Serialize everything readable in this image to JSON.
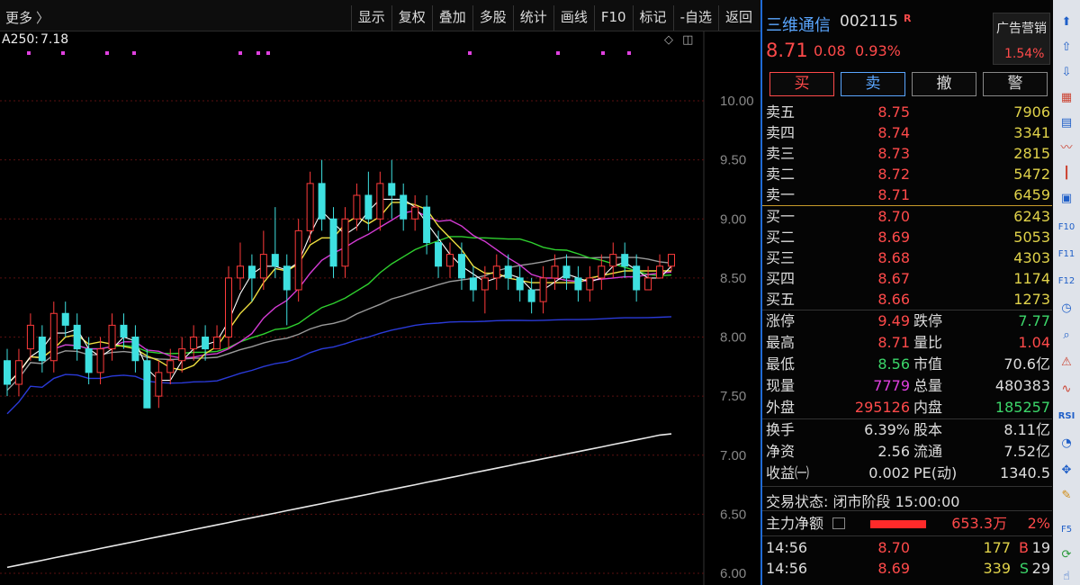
{
  "toolbar": {
    "more_label": "更多",
    "more_arrow": "〉",
    "buttons": [
      "显示",
      "复权",
      "叠加",
      "多股",
      "统计",
      "画线",
      "F10",
      "标记",
      "-自选",
      "返回"
    ]
  },
  "chart": {
    "ma_label": "A250:",
    "ma_value": "7.18",
    "price_axis": [
      "10.00",
      "9.50",
      "9.00",
      "8.50",
      "8.00",
      "7.50",
      "7.00",
      "6.50",
      "6.00"
    ],
    "candles": [
      [
        7.8,
        7.6,
        7.9,
        7.5
      ],
      [
        7.6,
        7.8,
        7.9,
        7.5
      ],
      [
        7.9,
        8.1,
        8.2,
        7.8
      ],
      [
        8.0,
        7.8,
        8.1,
        7.7
      ],
      [
        7.8,
        8.2,
        8.3,
        7.7
      ],
      [
        8.2,
        8.1,
        8.3,
        8.0
      ],
      [
        8.1,
        7.9,
        8.2,
        7.8
      ],
      [
        7.9,
        7.7,
        8.0,
        7.6
      ],
      [
        7.7,
        7.9,
        8.0,
        7.6
      ],
      [
        7.9,
        8.1,
        8.2,
        7.8
      ],
      [
        8.1,
        8.0,
        8.2,
        7.9
      ],
      [
        8.0,
        7.8,
        8.1,
        7.7
      ],
      [
        7.8,
        7.4,
        7.9,
        7.4
      ],
      [
        7.5,
        7.7,
        7.8,
        7.4
      ],
      [
        7.7,
        7.8,
        7.9,
        7.6
      ],
      [
        7.8,
        7.9,
        8.0,
        7.7
      ],
      [
        7.9,
        8.0,
        8.1,
        7.8
      ],
      [
        8.0,
        7.9,
        8.1,
        7.8
      ],
      [
        7.9,
        8.0,
        8.1,
        7.9
      ],
      [
        8.0,
        8.5,
        8.6,
        7.9
      ],
      [
        8.5,
        8.6,
        8.8,
        8.4
      ],
      [
        8.6,
        8.5,
        8.7,
        8.3
      ],
      [
        8.5,
        8.7,
        8.9,
        8.4
      ],
      [
        8.7,
        8.6,
        9.1,
        8.5
      ],
      [
        8.6,
        8.4,
        8.7,
        8.1
      ],
      [
        8.4,
        8.9,
        9.0,
        8.3
      ],
      [
        8.9,
        9.3,
        9.4,
        8.8
      ],
      [
        9.3,
        9.0,
        9.5,
        8.9
      ],
      [
        9.0,
        8.6,
        9.1,
        8.5
      ],
      [
        8.6,
        9.0,
        9.1,
        8.5
      ],
      [
        9.0,
        9.2,
        9.3,
        8.9
      ],
      [
        9.2,
        9.0,
        9.4,
        8.9
      ],
      [
        9.0,
        9.3,
        9.4,
        8.9
      ],
      [
        9.3,
        9.2,
        9.5,
        9.0
      ],
      [
        9.2,
        9.0,
        9.3,
        8.9
      ],
      [
        9.0,
        9.1,
        9.2,
        8.9
      ],
      [
        9.1,
        8.8,
        9.2,
        8.7
      ],
      [
        8.8,
        8.6,
        8.9,
        8.5
      ],
      [
        8.6,
        8.7,
        8.8,
        8.5
      ],
      [
        8.7,
        8.5,
        8.8,
        8.4
      ],
      [
        8.5,
        8.4,
        8.6,
        8.3
      ],
      [
        8.4,
        8.5,
        8.6,
        8.2
      ],
      [
        8.5,
        8.6,
        8.7,
        8.4
      ],
      [
        8.6,
        8.5,
        8.7,
        8.4
      ],
      [
        8.5,
        8.4,
        8.6,
        8.3
      ],
      [
        8.4,
        8.3,
        8.5,
        8.2
      ],
      [
        8.3,
        8.5,
        8.6,
        8.2
      ],
      [
        8.5,
        8.6,
        8.7,
        8.4
      ],
      [
        8.6,
        8.5,
        8.7,
        8.4
      ],
      [
        8.5,
        8.4,
        8.6,
        8.3
      ],
      [
        8.4,
        8.5,
        8.6,
        8.3
      ],
      [
        8.5,
        8.6,
        8.7,
        8.4
      ],
      [
        8.6,
        8.7,
        8.8,
        8.5
      ],
      [
        8.7,
        8.6,
        8.8,
        8.5
      ],
      [
        8.6,
        8.4,
        8.7,
        8.3
      ],
      [
        8.4,
        8.5,
        8.6,
        8.4
      ],
      [
        8.5,
        8.6,
        8.7,
        8.5
      ],
      [
        8.6,
        8.7,
        8.7,
        8.56
      ]
    ],
    "ma250": [
      6.05,
      6.07,
      6.09,
      6.11,
      6.13,
      6.15,
      6.17,
      6.19,
      6.21,
      6.23,
      6.25,
      6.27,
      6.29,
      6.31,
      6.33,
      6.35,
      6.37,
      6.39,
      6.41,
      6.43,
      6.45,
      6.47,
      6.49,
      6.51,
      6.53,
      6.55,
      6.57,
      6.59,
      6.61,
      6.63,
      6.65,
      6.67,
      6.69,
      6.71,
      6.73,
      6.75,
      6.77,
      6.79,
      6.81,
      6.83,
      6.85,
      6.87,
      6.89,
      6.91,
      6.93,
      6.95,
      6.97,
      6.99,
      7.01,
      7.03,
      7.05,
      7.07,
      7.09,
      7.11,
      7.13,
      7.15,
      7.17,
      7.18
    ]
  },
  "stock": {
    "name": "三维通信",
    "code": "002115",
    "mark": "R",
    "price": "8.71",
    "change": "0.08",
    "change_pct": "0.93%",
    "ad_label": "广告营销",
    "ad_pct": "1.54%"
  },
  "trade_buttons": {
    "buy": "买",
    "sell": "卖",
    "cancel": "撤",
    "alert": "警"
  },
  "asks": [
    {
      "label": "卖五",
      "price": "8.75",
      "vol": "7906"
    },
    {
      "label": "卖四",
      "price": "8.74",
      "vol": "3341"
    },
    {
      "label": "卖三",
      "price": "8.73",
      "vol": "2815"
    },
    {
      "label": "卖二",
      "price": "8.72",
      "vol": "5472"
    },
    {
      "label": "卖一",
      "price": "8.71",
      "vol": "6459"
    }
  ],
  "bids": [
    {
      "label": "买一",
      "price": "8.70",
      "vol": "6243"
    },
    {
      "label": "买二",
      "price": "8.69",
      "vol": "5053"
    },
    {
      "label": "买三",
      "price": "8.68",
      "vol": "4303"
    },
    {
      "label": "买四",
      "price": "8.67",
      "vol": "1174"
    },
    {
      "label": "买五",
      "price": "8.66",
      "vol": "1273"
    }
  ],
  "stats": [
    {
      "l1": "涨停",
      "v1": "9.49",
      "c1": "red",
      "l2": "跌停",
      "v2": "7.77",
      "c2": "green"
    },
    {
      "l1": "最高",
      "v1": "8.71",
      "c1": "red",
      "l2": "量比",
      "v2": "1.04",
      "c2": "red"
    },
    {
      "l1": "最低",
      "v1": "8.56",
      "c1": "green",
      "l2": "市值",
      "v2": "70.6亿",
      "c2": "white"
    },
    {
      "l1": "现量",
      "v1": "7779",
      "c1": "magenta",
      "l2": "总量",
      "v2": "480383",
      "c2": "white"
    },
    {
      "l1": "外盘",
      "v1": "295126",
      "c1": "red",
      "l2": "内盘",
      "v2": "185257",
      "c2": "green"
    }
  ],
  "stats2": [
    {
      "l1": "换手",
      "v1": "6.39%",
      "c1": "white",
      "l2": "股本",
      "v2": "8.11亿",
      "c2": "white"
    },
    {
      "l1": "净资",
      "v1": "2.56",
      "c1": "white",
      "l2": "流通",
      "v2": "7.52亿",
      "c2": "white"
    },
    {
      "l1": "收益㈠",
      "v1": "0.002",
      "c1": "white",
      "l2": "PE(动)",
      "v2": "1340.5",
      "c2": "white"
    }
  ],
  "trade_status": "交易状态: 闭市阶段 15:00:00",
  "flow": {
    "label": "主力净额",
    "value": "653.3万",
    "pct": "2%"
  },
  "ticks": [
    {
      "time": "14:56",
      "price": "8.70",
      "vol": "177",
      "bs": "B",
      "bs_color": "red",
      "n": "19"
    },
    {
      "time": "14:56",
      "price": "8.69",
      "vol": "339",
      "bs": "S",
      "bs_color": "green",
      "n": "29"
    }
  ],
  "side_icons": [
    "up-arrow-icon",
    "up-outline-icon",
    "down-outline-icon",
    "grid-icon",
    "table-icon",
    "line-chart-icon",
    "candle-icon",
    "window-icon",
    "f10-icon",
    "f11-icon",
    "f12-icon",
    "clock-icon",
    "hint-icon",
    "wave-icon",
    "rsi-icon",
    "gauge-icon",
    "move-icon",
    "pencil-icon",
    "f5-icon",
    "refresh-icon",
    "hand-icon"
  ],
  "colors": {
    "up": "#ff4a4a",
    "down": "#3cd66a",
    "accent": "#1f6bd6"
  }
}
